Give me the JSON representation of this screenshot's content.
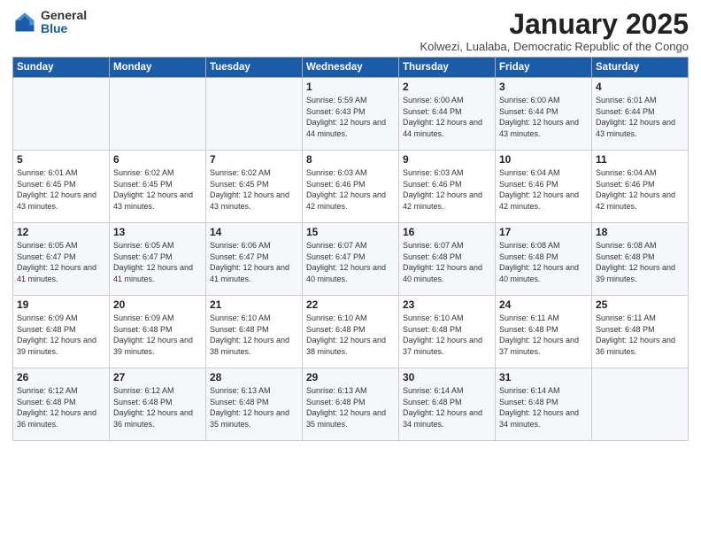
{
  "logo": {
    "general": "General",
    "blue": "Blue"
  },
  "title": "January 2025",
  "subtitle": "Kolwezi, Lualaba, Democratic Republic of the Congo",
  "headers": [
    "Sunday",
    "Monday",
    "Tuesday",
    "Wednesday",
    "Thursday",
    "Friday",
    "Saturday"
  ],
  "weeks": [
    [
      {
        "day": "",
        "sunrise": "",
        "sunset": "",
        "daylight": ""
      },
      {
        "day": "",
        "sunrise": "",
        "sunset": "",
        "daylight": ""
      },
      {
        "day": "",
        "sunrise": "",
        "sunset": "",
        "daylight": ""
      },
      {
        "day": "1",
        "sunrise": "Sunrise: 5:59 AM",
        "sunset": "Sunset: 6:43 PM",
        "daylight": "Daylight: 12 hours and 44 minutes."
      },
      {
        "day": "2",
        "sunrise": "Sunrise: 6:00 AM",
        "sunset": "Sunset: 6:44 PM",
        "daylight": "Daylight: 12 hours and 44 minutes."
      },
      {
        "day": "3",
        "sunrise": "Sunrise: 6:00 AM",
        "sunset": "Sunset: 6:44 PM",
        "daylight": "Daylight: 12 hours and 43 minutes."
      },
      {
        "day": "4",
        "sunrise": "Sunrise: 6:01 AM",
        "sunset": "Sunset: 6:44 PM",
        "daylight": "Daylight: 12 hours and 43 minutes."
      }
    ],
    [
      {
        "day": "5",
        "sunrise": "Sunrise: 6:01 AM",
        "sunset": "Sunset: 6:45 PM",
        "daylight": "Daylight: 12 hours and 43 minutes."
      },
      {
        "day": "6",
        "sunrise": "Sunrise: 6:02 AM",
        "sunset": "Sunset: 6:45 PM",
        "daylight": "Daylight: 12 hours and 43 minutes."
      },
      {
        "day": "7",
        "sunrise": "Sunrise: 6:02 AM",
        "sunset": "Sunset: 6:45 PM",
        "daylight": "Daylight: 12 hours and 43 minutes."
      },
      {
        "day": "8",
        "sunrise": "Sunrise: 6:03 AM",
        "sunset": "Sunset: 6:46 PM",
        "daylight": "Daylight: 12 hours and 42 minutes."
      },
      {
        "day": "9",
        "sunrise": "Sunrise: 6:03 AM",
        "sunset": "Sunset: 6:46 PM",
        "daylight": "Daylight: 12 hours and 42 minutes."
      },
      {
        "day": "10",
        "sunrise": "Sunrise: 6:04 AM",
        "sunset": "Sunset: 6:46 PM",
        "daylight": "Daylight: 12 hours and 42 minutes."
      },
      {
        "day": "11",
        "sunrise": "Sunrise: 6:04 AM",
        "sunset": "Sunset: 6:46 PM",
        "daylight": "Daylight: 12 hours and 42 minutes."
      }
    ],
    [
      {
        "day": "12",
        "sunrise": "Sunrise: 6:05 AM",
        "sunset": "Sunset: 6:47 PM",
        "daylight": "Daylight: 12 hours and 41 minutes."
      },
      {
        "day": "13",
        "sunrise": "Sunrise: 6:05 AM",
        "sunset": "Sunset: 6:47 PM",
        "daylight": "Daylight: 12 hours and 41 minutes."
      },
      {
        "day": "14",
        "sunrise": "Sunrise: 6:06 AM",
        "sunset": "Sunset: 6:47 PM",
        "daylight": "Daylight: 12 hours and 41 minutes."
      },
      {
        "day": "15",
        "sunrise": "Sunrise: 6:07 AM",
        "sunset": "Sunset: 6:47 PM",
        "daylight": "Daylight: 12 hours and 40 minutes."
      },
      {
        "day": "16",
        "sunrise": "Sunrise: 6:07 AM",
        "sunset": "Sunset: 6:48 PM",
        "daylight": "Daylight: 12 hours and 40 minutes."
      },
      {
        "day": "17",
        "sunrise": "Sunrise: 6:08 AM",
        "sunset": "Sunset: 6:48 PM",
        "daylight": "Daylight: 12 hours and 40 minutes."
      },
      {
        "day": "18",
        "sunrise": "Sunrise: 6:08 AM",
        "sunset": "Sunset: 6:48 PM",
        "daylight": "Daylight: 12 hours and 39 minutes."
      }
    ],
    [
      {
        "day": "19",
        "sunrise": "Sunrise: 6:09 AM",
        "sunset": "Sunset: 6:48 PM",
        "daylight": "Daylight: 12 hours and 39 minutes."
      },
      {
        "day": "20",
        "sunrise": "Sunrise: 6:09 AM",
        "sunset": "Sunset: 6:48 PM",
        "daylight": "Daylight: 12 hours and 39 minutes."
      },
      {
        "day": "21",
        "sunrise": "Sunrise: 6:10 AM",
        "sunset": "Sunset: 6:48 PM",
        "daylight": "Daylight: 12 hours and 38 minutes."
      },
      {
        "day": "22",
        "sunrise": "Sunrise: 6:10 AM",
        "sunset": "Sunset: 6:48 PM",
        "daylight": "Daylight: 12 hours and 38 minutes."
      },
      {
        "day": "23",
        "sunrise": "Sunrise: 6:10 AM",
        "sunset": "Sunset: 6:48 PM",
        "daylight": "Daylight: 12 hours and 37 minutes."
      },
      {
        "day": "24",
        "sunrise": "Sunrise: 6:11 AM",
        "sunset": "Sunset: 6:48 PM",
        "daylight": "Daylight: 12 hours and 37 minutes."
      },
      {
        "day": "25",
        "sunrise": "Sunrise: 6:11 AM",
        "sunset": "Sunset: 6:48 PM",
        "daylight": "Daylight: 12 hours and 36 minutes."
      }
    ],
    [
      {
        "day": "26",
        "sunrise": "Sunrise: 6:12 AM",
        "sunset": "Sunset: 6:48 PM",
        "daylight": "Daylight: 12 hours and 36 minutes."
      },
      {
        "day": "27",
        "sunrise": "Sunrise: 6:12 AM",
        "sunset": "Sunset: 6:48 PM",
        "daylight": "Daylight: 12 hours and 36 minutes."
      },
      {
        "day": "28",
        "sunrise": "Sunrise: 6:13 AM",
        "sunset": "Sunset: 6:48 PM",
        "daylight": "Daylight: 12 hours and 35 minutes."
      },
      {
        "day": "29",
        "sunrise": "Sunrise: 6:13 AM",
        "sunset": "Sunset: 6:48 PM",
        "daylight": "Daylight: 12 hours and 35 minutes."
      },
      {
        "day": "30",
        "sunrise": "Sunrise: 6:14 AM",
        "sunset": "Sunset: 6:48 PM",
        "daylight": "Daylight: 12 hours and 34 minutes."
      },
      {
        "day": "31",
        "sunrise": "Sunrise: 6:14 AM",
        "sunset": "Sunset: 6:48 PM",
        "daylight": "Daylight: 12 hours and 34 minutes."
      },
      {
        "day": "",
        "sunrise": "",
        "sunset": "",
        "daylight": ""
      }
    ]
  ]
}
